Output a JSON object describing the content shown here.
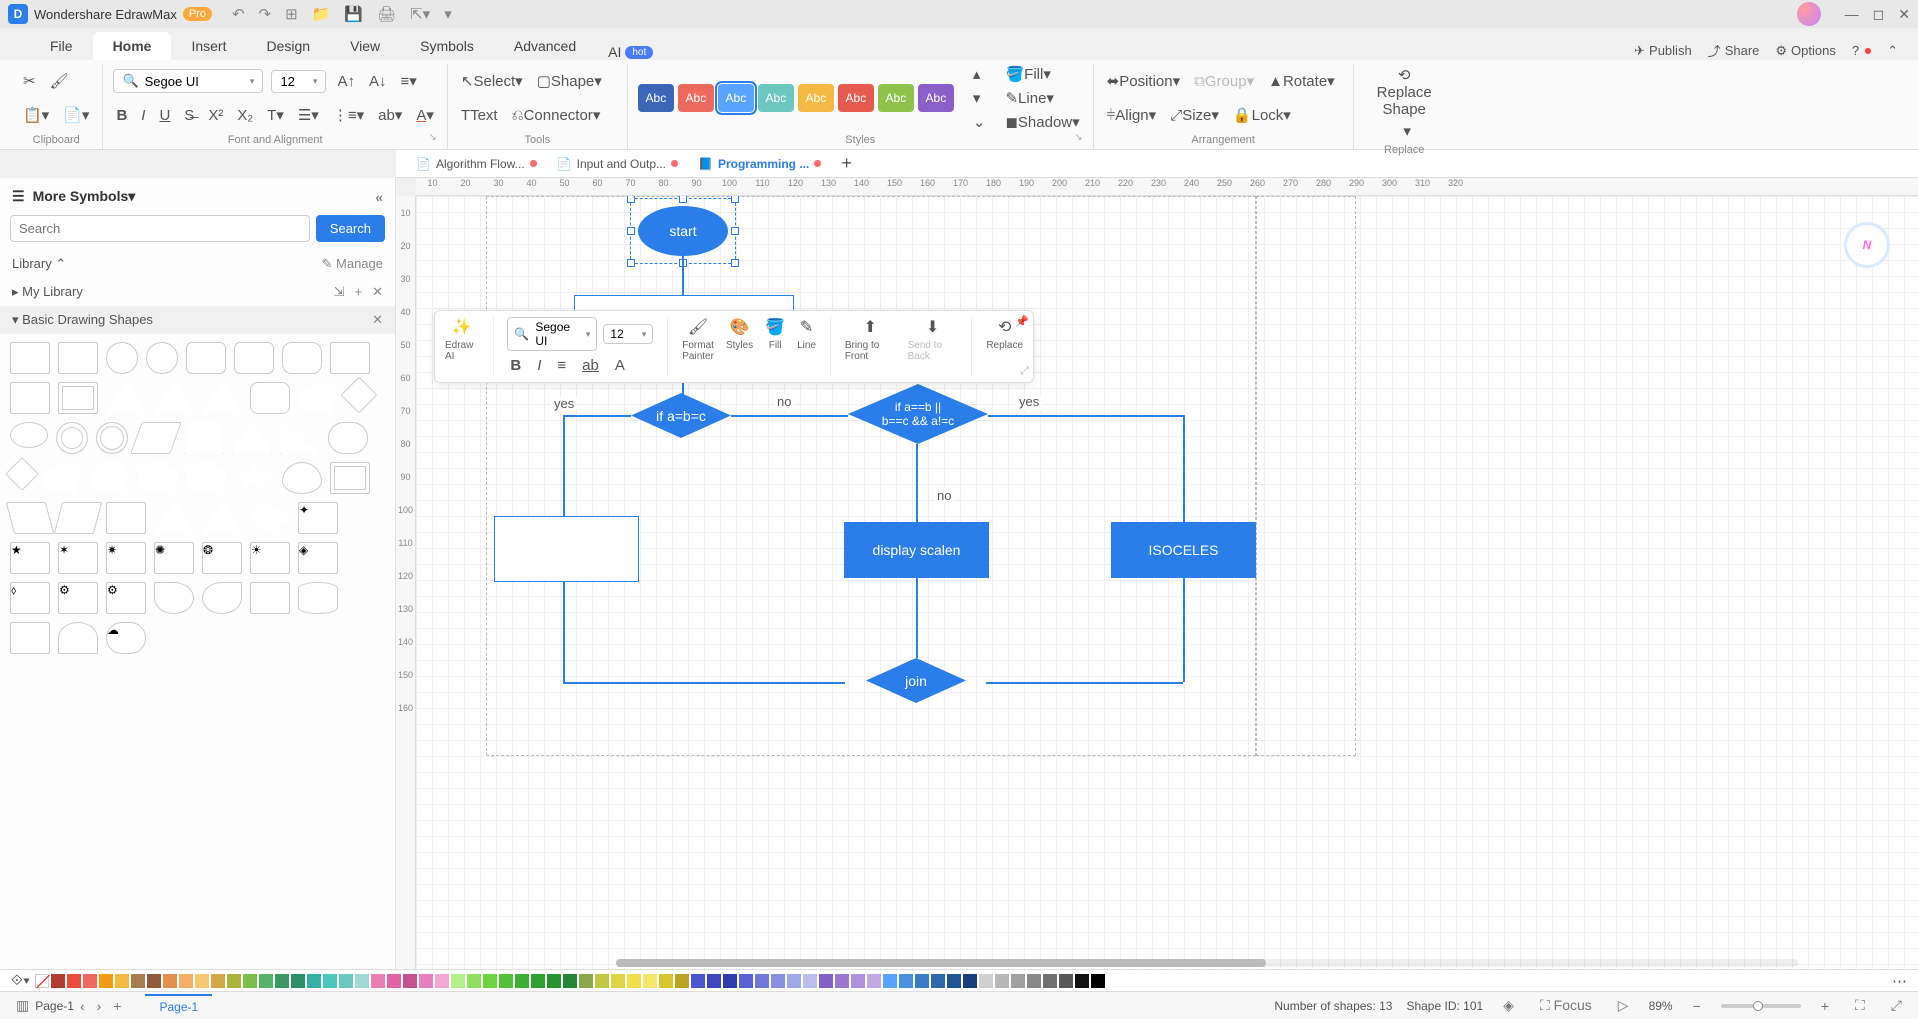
{
  "app": {
    "name": "Wondershare EdrawMax",
    "badge": "Pro"
  },
  "menu": {
    "tabs": [
      "File",
      "Home",
      "Insert",
      "Design",
      "View",
      "Symbols",
      "Advanced"
    ],
    "ai": "AI",
    "hot": "hot",
    "right": {
      "publish": "Publish",
      "share": "Share",
      "options": "Options"
    }
  },
  "font": {
    "name": "Segoe UI",
    "size": "12"
  },
  "ribbon": {
    "clipboard": "Clipboard",
    "fontalign": "Font and Alignment",
    "tools": "Tools",
    "styles": "Styles",
    "arrangement": "Arrangement",
    "replace": "Replace",
    "select": "Select",
    "shape": "Shape",
    "text": "Text",
    "connector": "Connector",
    "fill": "Fill",
    "line": "Line",
    "shadow": "Shadow",
    "position": "Position",
    "group": "Group",
    "rotate": "Rotate",
    "align": "Align",
    "size_lbl": "Size",
    "lock": "Lock",
    "replace_shape": "Replace\nShape",
    "abc": "Abc",
    "style_colors": [
      "#3d66b8",
      "#ec6a5e",
      "#57a3ff",
      "#6cc7c1",
      "#f4b942",
      "#e65a50",
      "#8fc24a",
      "#8a5fc7"
    ]
  },
  "doctabs": {
    "tabs": [
      {
        "title": "Algorithm Flow...",
        "mod": true
      },
      {
        "title": "Input and Outp...",
        "mod": true
      },
      {
        "title": "Programming ...",
        "mod": true,
        "active": true
      }
    ]
  },
  "left": {
    "title": "More Symbols",
    "search_ph": "Search",
    "search_btn": "Search",
    "library": "Library",
    "manage": "Manage",
    "mylib": "My Library",
    "basic": "Basic Drawing Shapes"
  },
  "ruler_ticks": [
    10,
    20,
    30,
    40,
    50,
    60,
    70,
    80,
    90,
    100,
    110,
    120,
    130,
    140,
    150,
    160,
    170,
    180,
    190,
    200,
    210,
    220,
    230,
    240,
    250,
    260,
    270,
    280,
    290,
    300,
    310,
    320
  ],
  "ruler_v": [
    10,
    20,
    30,
    40,
    50,
    60,
    70,
    80,
    90,
    100,
    110,
    120,
    130,
    140,
    150,
    160
  ],
  "flow": {
    "start": "start",
    "dec1": "if a=b=c",
    "dec2_l1": "if a==b ||",
    "dec2_l2": "b==c && a!=c",
    "yes": "yes",
    "no": "no",
    "no2": "no",
    "yes2": "yes",
    "box2": "display scalen",
    "box3": "ISOCELES",
    "join": "join"
  },
  "float": {
    "font": "Segoe UI",
    "size": "12",
    "ai": "Edraw AI",
    "fp": "Format\nPainter",
    "styles": "Styles",
    "fill": "Fill",
    "line": "Line",
    "btf": "Bring to Front",
    "stb": "Send to Back",
    "replace": "Replace"
  },
  "status": {
    "page": "Page-1",
    "page_active": "Page-1",
    "nshapes": "Number of shapes: 13",
    "shapeid": "Shape ID: 101",
    "focus": "Focus",
    "zoom": "89%"
  },
  "colors": [
    "#b23a2f",
    "#e84c3d",
    "#ec6a5e",
    "#f39c12",
    "#f4b942",
    "#a67c52",
    "#8e5a3a",
    "#e3904e",
    "#f5b066",
    "#f7c873",
    "#d4a84a",
    "#aab33c",
    "#7bbf4d",
    "#55b26a",
    "#3a9960",
    "#2f8f6a",
    "#35b0a5",
    "#4dc7bb",
    "#6cc7c1",
    "#a0d9d2",
    "#eb7fb3",
    "#e063a5",
    "#c7508f",
    "#e77fc0",
    "#f4a6d6",
    "#b2f08a",
    "#8fe060",
    "#6ed440",
    "#53c23a",
    "#3db033",
    "#2fa12f",
    "#289330",
    "#238538",
    "#8da84a",
    "#c0c847",
    "#e0d446",
    "#f2dd4a",
    "#f5e66d",
    "#d6c630",
    "#b8a323",
    "#4a56cf",
    "#3b46bf",
    "#2f3cae",
    "#5762d4",
    "#6e79da",
    "#8890e0",
    "#a0a8e6",
    "#b8bfeb",
    "#8560c7",
    "#9a78d1",
    "#af90db",
    "#c3a9e4",
    "#57a3ff",
    "#4a8fe0",
    "#3c7cc6",
    "#2f68ad",
    "#225595",
    "#173f7a",
    "#d0d0d0",
    "#b8b8b8",
    "#a0a0a0",
    "#888888",
    "#707070",
    "#585858",
    "#111111",
    "#000000",
    "#ffffff"
  ]
}
